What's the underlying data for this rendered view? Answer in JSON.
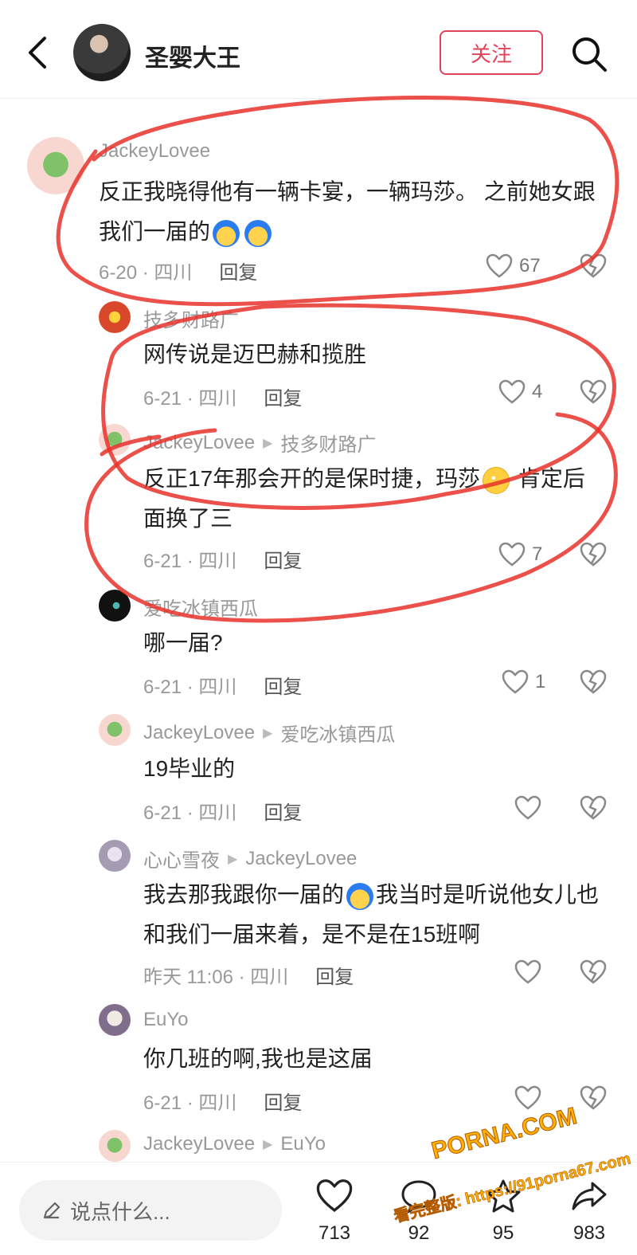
{
  "header": {
    "author_name": "圣婴大王",
    "follow_label": "关注"
  },
  "comments": [
    {
      "user": "JackeyLovee",
      "reply_to": "",
      "text_before": "反正我晓得他有一辆卡宴，一辆玛莎。 之前她女跟我们一届的",
      "text_after": "",
      "time": "6-20 · 四川",
      "reply_label": "回复",
      "likes": "67"
    },
    {
      "user": "技多财路广",
      "reply_to": "",
      "text_before": "网传说是迈巴赫和揽胜",
      "text_after": "",
      "time": "6-21 · 四川",
      "reply_label": "回复",
      "likes": "4"
    },
    {
      "user": "JackeyLovee",
      "reply_to": "技多财路广",
      "text_before": "反正17年那会开的是保时捷，玛莎",
      "text_after": " 肯定后面换了三",
      "time": "6-21 · 四川",
      "reply_label": "回复",
      "likes": "7"
    },
    {
      "user": "爱吃冰镇西瓜",
      "reply_to": "",
      "text_before": "哪一届?",
      "text_after": "",
      "time": "6-21 · 四川",
      "reply_label": "回复",
      "likes": "1"
    },
    {
      "user": "JackeyLovee",
      "reply_to": "爱吃冰镇西瓜",
      "text_before": "19毕业的",
      "text_after": "",
      "time": "6-21 · 四川",
      "reply_label": "回复",
      "likes": ""
    },
    {
      "user": "心心雪夜",
      "reply_to": "JackeyLovee",
      "text_before": "我去那我跟你一届的",
      "text_after": "我当时是听说他女儿也和我们一届来着，是不是在15班啊",
      "time": "昨天 11:06 · 四川",
      "reply_label": "回复",
      "likes": ""
    },
    {
      "user": "EuYo",
      "reply_to": "",
      "text_before": "你几班的啊,我也是这届",
      "text_after": "",
      "time": "6-21 · 四川",
      "reply_label": "回复",
      "likes": ""
    },
    {
      "user": "JackeyLovee",
      "reply_to": "EuYo",
      "text_before": "",
      "text_after": "",
      "time": "",
      "reply_label": "",
      "likes": ""
    }
  ],
  "bottom_bar": {
    "input_placeholder": "说点什么...",
    "like_count": "713",
    "comment_count": "92",
    "star_count": "95",
    "share_count": "983"
  },
  "watermark": {
    "main": "PORNA.COM",
    "sub": "看完整版: https://91porna67.com"
  },
  "colors": {
    "accent": "#e0435a",
    "scribble": "#e8312a",
    "muted_text": "#999999"
  },
  "icons": [
    "back-arrow-icon",
    "search-icon",
    "heart-icon",
    "broken-heart-icon",
    "pencil-icon",
    "comment-icon",
    "star-icon",
    "share-icon"
  ]
}
